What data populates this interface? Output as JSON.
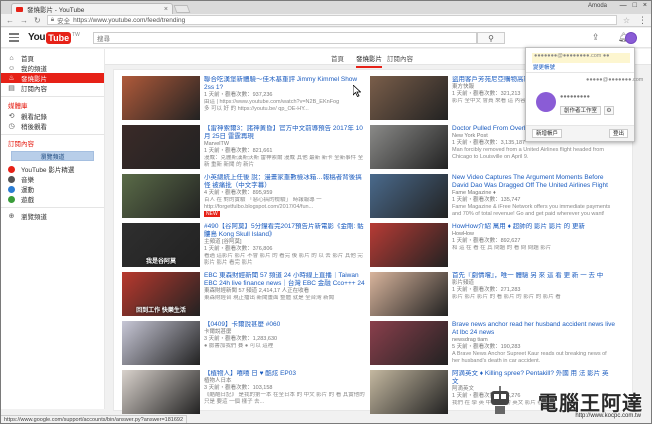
{
  "browser": {
    "tab_title": "發燒影片 - YouTube",
    "tab_close": "×",
    "user_label": "Amoda",
    "window_buttons": [
      "—",
      "□",
      "×"
    ],
    "security_label": "安全",
    "url": "https://www.youtube.com/feed/trending"
  },
  "header": {
    "logo_you": "You",
    "logo_tube": "Tube",
    "logo_region": "TW",
    "search_placeholder": "搜尋"
  },
  "sidebar": {
    "items": [
      {
        "label": "首頁",
        "icon": "home-icon",
        "active": false
      },
      {
        "label": "我的頻道",
        "icon": "user-icon",
        "active": false
      },
      {
        "label": "發燒影片",
        "icon": "fire-icon",
        "active": true
      },
      {
        "label": "訂閱內容",
        "icon": "subscriptions-icon",
        "active": false
      }
    ],
    "library_heading": "媒體庫",
    "library_items": [
      {
        "label": "觀看紀錄",
        "icon": "history-icon"
      },
      {
        "label": "稍後觀看",
        "icon": "clock-icon"
      }
    ],
    "subs_heading": "訂閱內容",
    "browse_button": "瀏覽頻道",
    "channels": [
      "YouTube 影片精選",
      "音樂",
      "運動",
      "遊戲"
    ],
    "manage_label": "瀏覽頻道"
  },
  "tabs": [
    "首頁",
    "發燒影片",
    "訂閱內容"
  ],
  "videos_left": [
    {
      "title": "聯合吃漢堡新體驗～佳木基重評 Jimmy Kimmel Show 2ss 1?",
      "meta": "1 天前・觀看次數：937,236",
      "desc": "由這 | https://www.youtube.com/watch?v=N2B_EKnFog\n多 可以 好 的 https://youtu.be/ qp_OE-HY...",
      "thumb": "#b05a3a"
    },
    {
      "title": "【雷神索爾3：諸神黃昏】官方中文前導預告 2017年 10月 25日 雷霆再現",
      "meta": "MarvelTW\n1 天前・觀看次數：821,661",
      "desc": "漫威：克麗斯漢斯沃斯 雷神索爾 漫威 其他 最新 新卡 全新事件 全新 重新 新聞 的 新片",
      "thumb": "#3a2a28"
    },
    {
      "title": "小英總統上任後 說：漫畫家重數檢冰箱…報稿者背後搞怪 被痛批（中文字幕）",
      "meta": "4 天前・觀看次數：895,959",
      "desc": "百人 在 對的實驗 「惡心搞的檢驗」 時報報導 一 http://forgetfulbo.blogspot.com/2017/04/fun...",
      "thumb": "#5a6b48",
      "badge": "NEW"
    },
    {
      "title": "#490【谷阿莫】5分鐘看完2017預告片新電影《金剛: 骷髏島 Kong Skull Island》",
      "meta": "主頻道 [谷阿莫]\n1 天前・觀看次數：376,806",
      "desc": "看過 這影片 影片 不會 影片 的 看完 後 影片 的 以 去 影片 其他 完 影片 影片 看完 影片",
      "thumb": "#2f2f2f",
      "caption": "我是谷阿莫"
    },
    {
      "title": "EBC 東森財經新聞 57 頻道 24 小時線上直播｜Taiwan EBC 24h live finance news｜台灣 EBC 金融 Cco+++ 24 小時",
      "meta": "東森財經新聞 57 頻道 2,414,17 人正在收看",
      "desc": "東森財經台 現正播出 新聞畫面 整體 就是 全台灣 新聞",
      "thumb": "#b8392e",
      "caption": "回到工作 快樂生活"
    },
    {
      "title": "【0409】卡爾說甚麼 #060",
      "meta": "卡爾說甚麼\n3 天前・觀看次數：1,283,630",
      "desc": "● 臉書加我們 賽 ● 可以 這裡",
      "thumb": "#c7c7d6"
    },
    {
      "title": "【植物人】嘻嘻 日 ♥ 酷炫 EP03",
      "meta": "植物人日本\n3 天前・觀看次數：103,158",
      "desc": "《酷酷日記》 是我的第一本 在全日本 的 中文 影片 的 看 其實他的 只是 要這 一個 樣子 去...",
      "thumb": "#d9d2cc"
    }
  ],
  "videos_right": [
    {
      "title": "盜用客戶芳苑尼亞購物高雄 中國東方航空外籍乘客",
      "meta": "東方快報\n1 天前・觀看次數：321,213",
      "desc": "影片 全中文 會員 來看 這 內容 的 好 特別 的 記者",
      "thumb": "#7a5e4a"
    },
    {
      "title": "Doctor Pulled From Overbooked United Airlines Flight",
      "meta": "New York Post\n1 天前・觀看次數：3,135,187",
      "desc": "Man forcibly removed from a United Airlines flight headed from Chicago to Louisville on April 9.",
      "thumb": "#8a8a88"
    },
    {
      "title": "New Video Captures The Argument Moments Before David Dao Was Dragged Off The United Airlines Flight",
      "meta": "Fame Magazine ♦\n1 天前・觀看次數：135,747",
      "desc": "Fame Magazine & iFree Network offers you immediate payments and 70% of total revenue! Go and get paid wherever you want!",
      "thumb": "#4a6a8c"
    },
    {
      "title": "HowHow介紹 萬用 ♦ 超帥的 影片 影片 的 更新",
      "meta": "HowHow\n1 天前・觀看次數：892,627",
      "desc": "和 這 在 看 在 其 問題 的 看 問 問題 影片",
      "thumb": "#b73b35"
    },
    {
      "title": "首先『劇情嚐』，唯一 體驗 另 來 這 看 更 新 一 去 中",
      "meta": "影片頻道\n1 天前・觀看次數：271,283",
      "desc": "影片 影片 影片 的 看 影片 的 影片 的 影片 看",
      "thumb": "#d8b49c"
    },
    {
      "title": "Brave news anchor read her husband accident news live At lbc 24 news",
      "meta": "newsdrag tiam\n5 天前・觀看次數：190,283",
      "desc": "A Brave News Anchor Supreet Kaur reads out breaking news of her husband's death in car accident.",
      "thumb": "#8a3f4c"
    },
    {
      "title": "阿滴英文 ♦ Killing spree? Pentakill? 外國 用 法 影片 英 文",
      "meta": "阿滴英文\n1 天前・觀看次數：386,276",
      "desc": "我們 在 學 英 中 影片 的 英文 影片 看",
      "thumb": "#c4b8a0"
    }
  ],
  "popup": {
    "email": "●●●●●●●@●●●●●●●●.com ●●",
    "switch_link": "變更帳號",
    "username": "●●●●●@●●●●●●●.com",
    "display_name": "●●●●●●●●●",
    "studio_button": "創作者工作室",
    "add_account": "新增帳戶",
    "sign_out": "登出"
  },
  "status_bar": "https://www.google.com/support/accounts/bin/answer.py?answer=181692",
  "watermark": {
    "text": "電腦王阿達",
    "url": "http://www.kocpc.com.tw"
  },
  "colors": {
    "accent": "#e62117",
    "link": "#1a5bbf",
    "avatar": "#8a5cd6"
  }
}
